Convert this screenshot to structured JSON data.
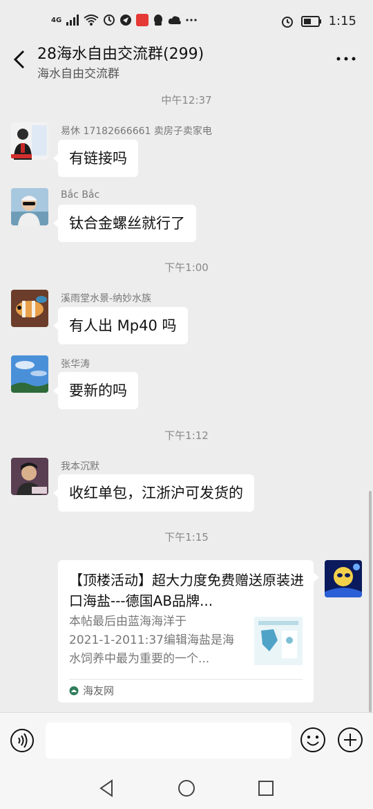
{
  "status_bar": {
    "network": "4G",
    "time": "1:15",
    "icons": [
      "signal-icon",
      "wifi-icon",
      "sync-icon",
      "notification-icon",
      "app-icon",
      "qq-icon",
      "cloud-icon",
      "more-dots",
      "alarm-icon",
      "battery-icon"
    ]
  },
  "header": {
    "title": "28海水自由交流群(299)",
    "subtitle": "海水自由交流群",
    "back_icon": "chevron-left-icon",
    "more_icon": "more-horizontal-icon"
  },
  "messages": [
    {
      "type": "timestamp",
      "text": "中午12:37"
    },
    {
      "type": "text",
      "sender": "易休  17182666661 卖房子卖家电",
      "content": "有链接吗"
    },
    {
      "type": "text",
      "sender": "Bắc Bắc",
      "content": "钛合金螺丝就行了"
    },
    {
      "type": "timestamp",
      "text": "下午1:00"
    },
    {
      "type": "text",
      "sender": "溪雨堂水景-纳妙水族",
      "content": "有人出 Mp40 吗"
    },
    {
      "type": "text",
      "sender": "张华涛",
      "content": "要新的吗"
    },
    {
      "type": "timestamp",
      "text": "下午1:12"
    },
    {
      "type": "text",
      "sender": "我本沉默",
      "content": "收红单包，江浙沪可发货的"
    },
    {
      "type": "timestamp",
      "text": "下午1:15"
    },
    {
      "type": "link",
      "title": "【顶楼活动】超大力度免费赠送原装进口海盐---德国AB品牌...",
      "desc_line1": "本帖最后由蓝海海洋于",
      "desc_line2": "2021-1-2011:37编辑海盐是海",
      "desc_line3": "水饲养中最为重要的一个...",
      "source": "海友网"
    }
  ],
  "input_bar": {
    "voice_icon": "voice-icon",
    "emoji_icon": "emoji-icon",
    "plus_icon": "plus-circle-icon",
    "text_value": ""
  },
  "nav_bar": {
    "icons": [
      "back-triangle-icon",
      "home-circle-icon",
      "recents-square-icon"
    ]
  },
  "colors": {
    "background": "#ededed",
    "bubble": "#ffffff",
    "timestamp": "#888888"
  }
}
